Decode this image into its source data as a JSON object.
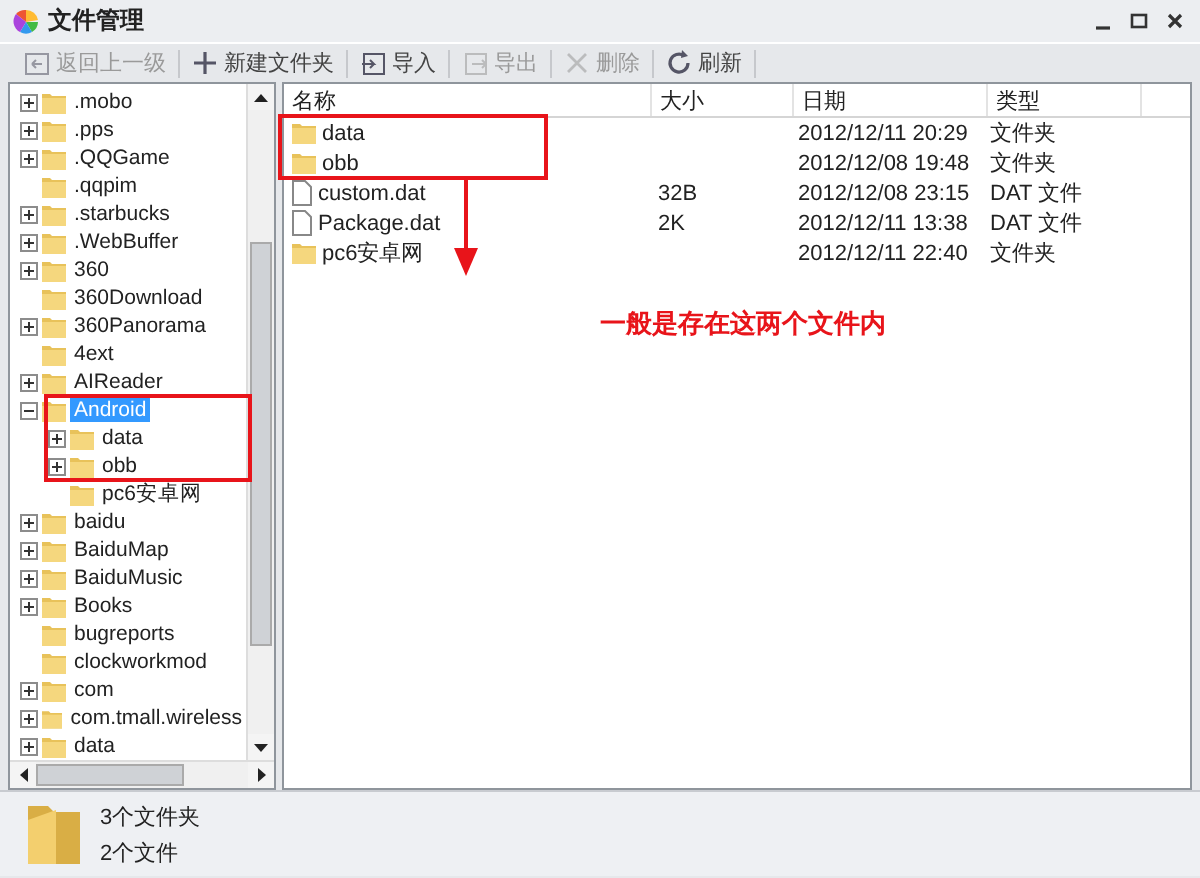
{
  "window": {
    "title": "文件管理"
  },
  "toolbar": [
    {
      "label": "返回上一级",
      "kind": "back",
      "disabled": true
    },
    {
      "label": "新建文件夹",
      "kind": "new",
      "disabled": false
    },
    {
      "label": "导入",
      "kind": "import",
      "disabled": false
    },
    {
      "label": "导出",
      "kind": "export",
      "disabled": true
    },
    {
      "label": "删除",
      "kind": "delete",
      "disabled": true
    },
    {
      "label": "刷新",
      "kind": "refresh",
      "disabled": false
    }
  ],
  "tree": {
    "items": [
      {
        "label": ".mobo",
        "expandable": true,
        "expanded": false,
        "selected": false
      },
      {
        "label": ".pps",
        "expandable": true,
        "expanded": false,
        "selected": false
      },
      {
        "label": ".QQGame",
        "expandable": true,
        "expanded": false,
        "selected": false
      },
      {
        "label": ".qqpim",
        "expandable": false,
        "selected": false
      },
      {
        "label": ".starbucks",
        "expandable": true,
        "expanded": false,
        "selected": false
      },
      {
        "label": ".WebBuffer",
        "expandable": true,
        "expanded": false,
        "selected": false
      },
      {
        "label": "360",
        "expandable": true,
        "expanded": false,
        "selected": false
      },
      {
        "label": "360Download",
        "expandable": false,
        "selected": false
      },
      {
        "label": "360Panorama",
        "expandable": true,
        "expanded": false,
        "selected": false
      },
      {
        "label": "4ext",
        "expandable": false,
        "selected": false
      },
      {
        "label": "AIReader",
        "expandable": true,
        "expanded": false,
        "selected": false
      },
      {
        "label": "Android",
        "expandable": true,
        "expanded": true,
        "selected": true,
        "children": [
          {
            "label": "data",
            "expandable": true,
            "expanded": false,
            "selected": false
          },
          {
            "label": "obb",
            "expandable": true,
            "expanded": false,
            "selected": false
          },
          {
            "label": "pc6安卓网",
            "expandable": false,
            "selected": false
          }
        ]
      },
      {
        "label": "baidu",
        "expandable": true,
        "expanded": false,
        "selected": false
      },
      {
        "label": "BaiduMap",
        "expandable": true,
        "expanded": false,
        "selected": false
      },
      {
        "label": "BaiduMusic",
        "expandable": true,
        "expanded": false,
        "selected": false
      },
      {
        "label": "Books",
        "expandable": true,
        "expanded": false,
        "selected": false
      },
      {
        "label": "bugreports",
        "expandable": false,
        "selected": false
      },
      {
        "label": "clockworkmod",
        "expandable": false,
        "selected": false
      },
      {
        "label": "com",
        "expandable": true,
        "expanded": false,
        "selected": false
      },
      {
        "label": "com.tmall.wireless",
        "expandable": true,
        "expanded": false,
        "selected": false
      },
      {
        "label": "data",
        "expandable": true,
        "expanded": false,
        "selected": false
      }
    ]
  },
  "table": {
    "columns": [
      "名称",
      "大小",
      "日期",
      "类型"
    ],
    "rows": [
      {
        "kind": "folder",
        "name": "data",
        "size": "",
        "date": "2012/12/11 20:29",
        "type": "文件夹"
      },
      {
        "kind": "folder",
        "name": "obb",
        "size": "",
        "date": "2012/12/08 19:48",
        "type": "文件夹"
      },
      {
        "kind": "file",
        "name": "custom.dat",
        "size": "32B",
        "date": "2012/12/08 23:15",
        "type": "DAT 文件"
      },
      {
        "kind": "file",
        "name": "Package.dat",
        "size": "2K",
        "date": "2012/12/11 13:38",
        "type": "DAT 文件"
      },
      {
        "kind": "folder",
        "name": "pc6安卓网",
        "size": "",
        "date": "2012/12/11 22:40",
        "type": "文件夹"
      }
    ]
  },
  "annotation": "一般是存在这两个文件内",
  "status_bar": [
    "3个文件夹",
    "2个文件"
  ]
}
